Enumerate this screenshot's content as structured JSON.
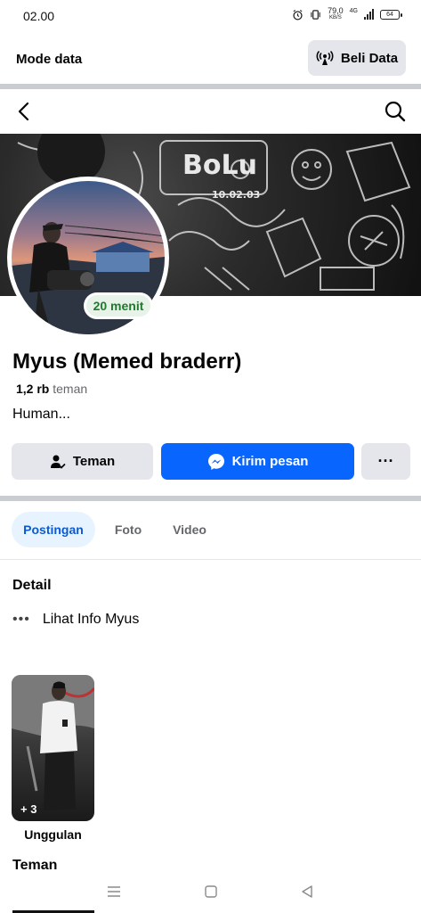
{
  "status_bar": {
    "time": "02.00",
    "speed_value": "79,0",
    "speed_unit": "KB/S",
    "network": "4G",
    "battery": "64"
  },
  "mode_bar": {
    "label": "Mode data",
    "buy_button": "Beli Data"
  },
  "cover": {
    "graffiti_1": "BoLu",
    "graffiti_2": "10.02.03"
  },
  "profile": {
    "active_badge": "20 menit",
    "name": "Myus (Memed braderr)",
    "friend_count": "1,2 rb",
    "friend_label": "teman",
    "bio": "Human..."
  },
  "actions": {
    "friends_button": "Teman",
    "message_button": "Kirim pesan",
    "more_button": "···"
  },
  "tabs": [
    {
      "label": "Postingan",
      "active": true
    },
    {
      "label": "Foto",
      "active": false
    },
    {
      "label": "Video",
      "active": false
    }
  ],
  "details": {
    "title": "Detail",
    "info_dots": "•••",
    "info_link": "Lihat Info Myus"
  },
  "featured": {
    "count": "+ 3",
    "label": "Unggulan"
  },
  "friends_section": {
    "title": "Teman"
  },
  "colors": {
    "accent": "#0866ff",
    "active_badge_text": "#1f7a2e",
    "tab_active_bg": "#e7f3ff"
  }
}
